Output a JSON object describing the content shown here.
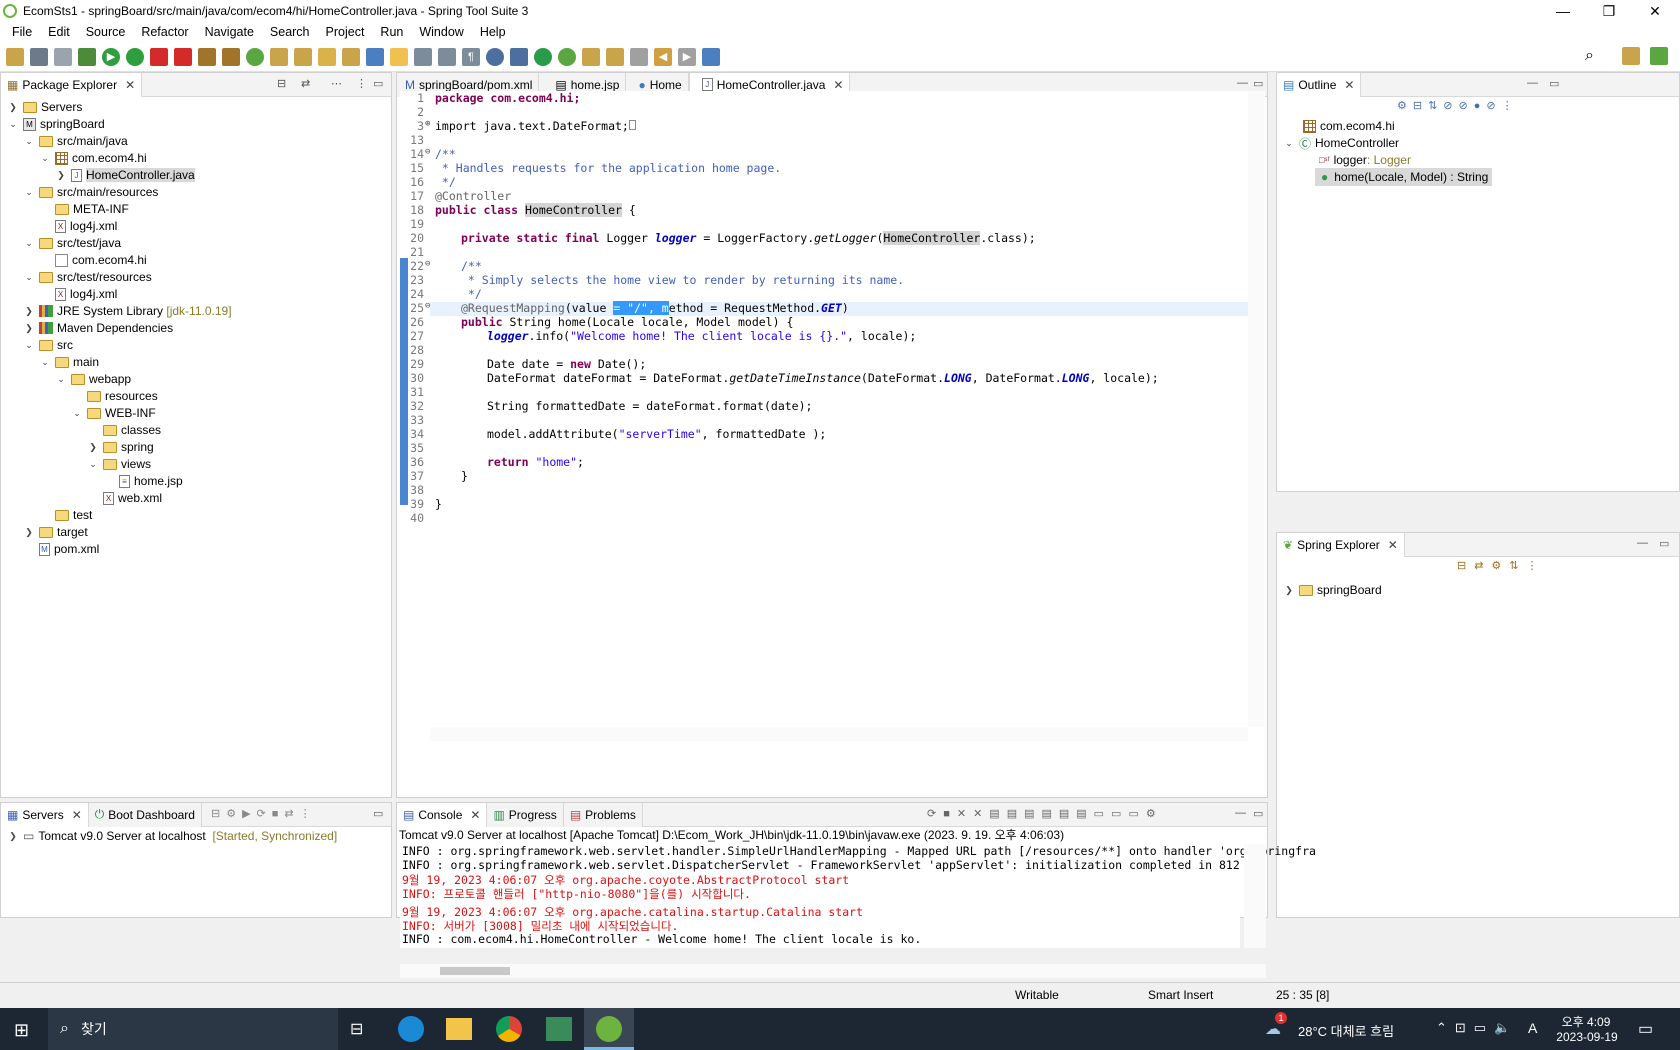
{
  "window": {
    "title": "EcomSts1 - springBoard/src/main/java/com/ecom4/hi/HomeController.java - Spring Tool Suite 3"
  },
  "menu": [
    "File",
    "Edit",
    "Source",
    "Refactor",
    "Navigate",
    "Search",
    "Project",
    "Run",
    "Window",
    "Help"
  ],
  "package_explorer": {
    "tab": "Package Explorer",
    "items": [
      "Servers",
      "springBoard",
      "src/main/java",
      "com.ecom4.hi",
      "HomeController.java",
      "src/main/resources",
      "META-INF",
      "log4j.xml",
      "src/test/java",
      "com.ecom4.hi",
      "src/test/resources",
      "log4j.xml",
      "JRE System Library",
      "Maven Dependencies",
      "src",
      "main",
      "webapp",
      "resources",
      "WEB-INF",
      "classes",
      "spring",
      "views",
      "home.jsp",
      "web.xml",
      "test",
      "target",
      "pom.xml"
    ],
    "jre_version": "[jdk-11.0.19]"
  },
  "editor": {
    "tabs": [
      "springBoard/pom.xml",
      "home.jsp",
      "Home",
      "HomeController.java"
    ]
  },
  "code": {
    "line_numbers": [
      "1",
      "2",
      "3",
      "13",
      "14",
      "15",
      "16",
      "17",
      "18",
      "19",
      "20",
      "21",
      "22",
      "23",
      "24",
      "25",
      "26",
      "27",
      "28",
      "29",
      "30",
      "31",
      "32",
      "33",
      "34",
      "35",
      "36",
      "37",
      "38",
      "39",
      "40"
    ],
    "pkg": "package com.ecom4.hi;",
    "imp": "import java.text.DateFormat;",
    "c14": "/**",
    "c15": " * Handles requests for the application home page.",
    "c16": " */",
    "a17": "@Controller",
    "l18_kw": "public class ",
    "l18_name": "HomeController",
    "l18_rest": " {",
    "l20_kw": "private static final ",
    "l20_a": "Logger ",
    "l20_f": "logger",
    "l20_b": " = LoggerFactory.",
    "l20_m": "getLogger",
    "l20_c": "(",
    "l20_d": "HomeController",
    "l20_e": ".class);",
    "c22": "/**",
    "c23": " * Simply selects the home view to render by returning its name.",
    "c24": " */",
    "l25_a": "@RequestMapping",
    "l25_b": "(value ",
    "l25_sel": "= \"/\", m",
    "l25_c": "ethod = RequestMethod.",
    "l25_d": "GET",
    "l25_e": ")",
    "l26_kw": "public ",
    "l26_rest": "String home(Locale ",
    "l26_p1": "locale",
    "l26_r2": ", Model ",
    "l26_p2": "model",
    "l26_r3": ") {",
    "l27_f": "logger",
    "l27_a": ".info(",
    "l27_s": "\"Welcome home! The client locale is {}.\"",
    "l27_b": ", ",
    "l27_p": "locale",
    "l27_c": ");",
    "l29_a": "Date ",
    "l29_v": "date",
    "l29_b": " = ",
    "l29_kw": "new ",
    "l29_c": "Date();",
    "l30_a": "DateFormat ",
    "l30_v": "dateFormat",
    "l30_b": " = DateFormat.",
    "l30_m": "getDateTimeInstance",
    "l30_c": "(DateFormat.",
    "l30_f1": "LONG",
    "l30_d": ", DateFormat.",
    "l30_f2": "LONG",
    "l30_e": ", ",
    "l30_p": "locale",
    "l30_g": ");",
    "l32_a": "String ",
    "l32_v": "formattedDate",
    "l32_b": " = ",
    "l32_v2": "dateFormat",
    "l32_c": ".format(",
    "l32_v3": "date",
    "l32_d": ");",
    "l34_v": "model",
    "l34_a": ".addAttribute(",
    "l34_s": "\"serverTime\"",
    "l34_b": ", ",
    "l34_v2": "formattedDate",
    "l34_c": " );",
    "l36_kw": "return ",
    "l36_s": "\"home\"",
    "l36_c": ";",
    "l37": "}",
    "l39": "}"
  },
  "outline": {
    "tab": "Outline",
    "items": [
      "com.ecom4.hi",
      "HomeController",
      "logger",
      "home(Locale, Model) : String"
    ],
    "logger_type": " : Logger"
  },
  "spring_explorer": {
    "tab": "Spring Explorer",
    "items": [
      "springBoard"
    ]
  },
  "servers": {
    "tabs": [
      "Servers",
      "Boot Dashboard"
    ],
    "item": "Tomcat v9.0 Server at localhost",
    "status": "[Started, Synchronized]"
  },
  "console": {
    "tabs": [
      "Console",
      "Progress",
      "Problems"
    ],
    "header": "Tomcat v9.0 Server at localhost [Apache Tomcat] D:\\Ecom_Work_JH\\bin\\jdk-11.0.19\\bin\\javaw.exe  (2023. 9. 19. 오후 4:06:03)",
    "lines": [
      "INFO : org.springframework.web.servlet.handler.SimpleUrlHandlerMapping - Mapped URL path [/resources/**] onto handler 'org.springfra",
      "INFO : org.springframework.web.servlet.DispatcherServlet - FrameworkServlet 'appServlet': initialization completed in 812 ms",
      "9월 19, 2023 4:06:07 오후 org.apache.coyote.AbstractProtocol start",
      "INFO: 프로토콜 핸들러 [\"http-nio-8080\"]을(를) 시작합니다.",
      "9월 19, 2023 4:06:07 오후 org.apache.catalina.startup.Catalina start",
      "INFO: 서버가 [3008] 밀리초 내에 시작되었습니다.",
      "INFO : com.ecom4.hi.HomeController - Welcome home! The client locale is ko."
    ]
  },
  "status": {
    "writable": "Writable",
    "insert": "Smart Insert",
    "position": "25 : 35 [8]"
  },
  "taskbar": {
    "search": "찾기",
    "weather": "28°C  대체로 흐림",
    "time": "오후 4:09",
    "date": "2023-09-19",
    "ime": "A",
    "notif_count": "1"
  }
}
